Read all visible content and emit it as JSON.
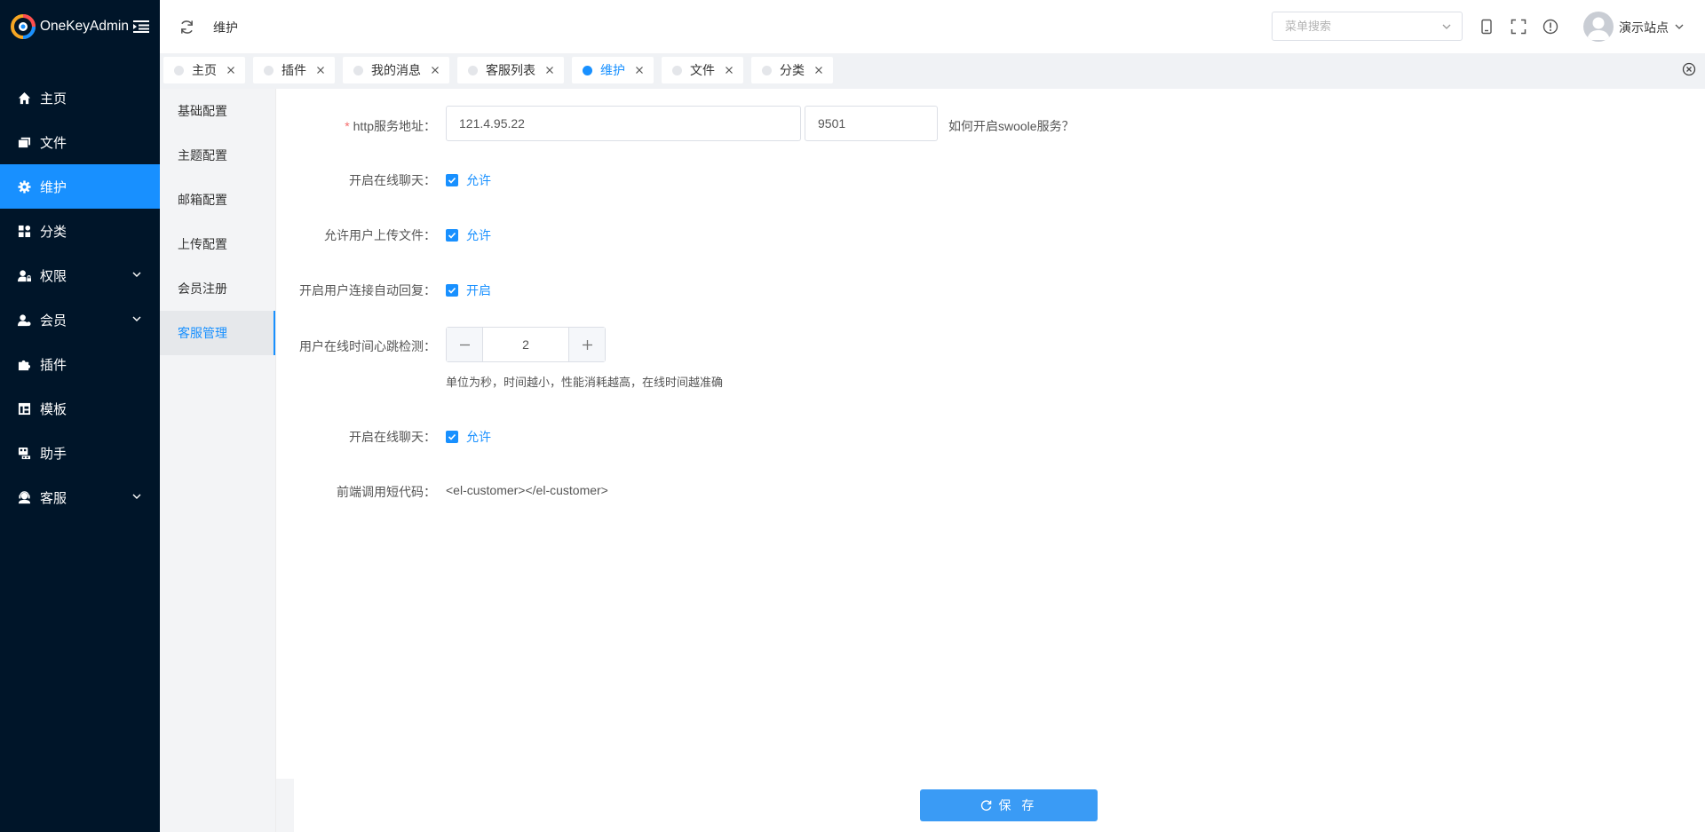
{
  "brand": {
    "name": "OneKeyAdmin",
    "logo_colors": [
      "#f5a623",
      "#1890ff",
      "#ff4d4f"
    ]
  },
  "sidebar": {
    "active_color": "#1890ff",
    "items": [
      {
        "label": "主页",
        "icon": "home-icon",
        "active": false,
        "has_children": false
      },
      {
        "label": "文件",
        "icon": "folder-icon",
        "active": false,
        "has_children": false
      },
      {
        "label": "维护",
        "icon": "gear-icon",
        "active": true,
        "has_children": false
      },
      {
        "label": "分类",
        "icon": "grid-icon",
        "active": false,
        "has_children": false
      },
      {
        "label": "权限",
        "icon": "user-lock-icon",
        "active": false,
        "has_children": true
      },
      {
        "label": "会员",
        "icon": "user-icon",
        "active": false,
        "has_children": true
      },
      {
        "label": "插件",
        "icon": "puzzle-icon",
        "active": false,
        "has_children": false
      },
      {
        "label": "模板",
        "icon": "template-icon",
        "active": false,
        "has_children": false
      },
      {
        "label": "助手",
        "icon": "robot-icon",
        "active": false,
        "has_children": false
      },
      {
        "label": "客服",
        "icon": "headset-icon",
        "active": false,
        "has_children": true
      }
    ]
  },
  "header": {
    "breadcrumb": "维护",
    "search": {
      "placeholder": "菜单搜索",
      "value": ""
    },
    "user": {
      "name": "演示站点"
    }
  },
  "tabs": [
    {
      "label": "主页",
      "active": false
    },
    {
      "label": "插件",
      "active": false
    },
    {
      "label": "我的消息",
      "active": false
    },
    {
      "label": "客服列表",
      "active": false
    },
    {
      "label": "维护",
      "active": true
    },
    {
      "label": "文件",
      "active": false
    },
    {
      "label": "分类",
      "active": false
    }
  ],
  "config_nav": [
    {
      "label": "基础配置",
      "active": false
    },
    {
      "label": "主题配置",
      "active": false
    },
    {
      "label": "邮箱配置",
      "active": false
    },
    {
      "label": "上传配置",
      "active": false
    },
    {
      "label": "会员注册",
      "active": false
    },
    {
      "label": "客服管理",
      "active": true
    }
  ],
  "form": {
    "http": {
      "label": "http服务地址：",
      "required_mark": "*",
      "host": "121.4.95.22",
      "port": "9501",
      "help": "如何开启swoole服务？"
    },
    "online_chat": {
      "label": "开启在线聊天：",
      "option": "允许",
      "checked": true
    },
    "allow_upload": {
      "label": "允许用户上传文件：",
      "option": "允许",
      "checked": true
    },
    "auto_reply": {
      "label": "开启用户连接自动回复：",
      "option": "开启",
      "checked": true
    },
    "heartbeat": {
      "label": "用户在线时间心跳检测：",
      "value": "2",
      "hint": "单位为秒，时间越小，性能消耗越高，在线时间越准确"
    },
    "online_chat_2": {
      "label": "开启在线聊天：",
      "option": "允许",
      "checked": true
    },
    "shortcode": {
      "label": "前端调用短代码：",
      "value": "<el-customer></el-customer>"
    }
  },
  "footer": {
    "save_label": "保 存"
  }
}
